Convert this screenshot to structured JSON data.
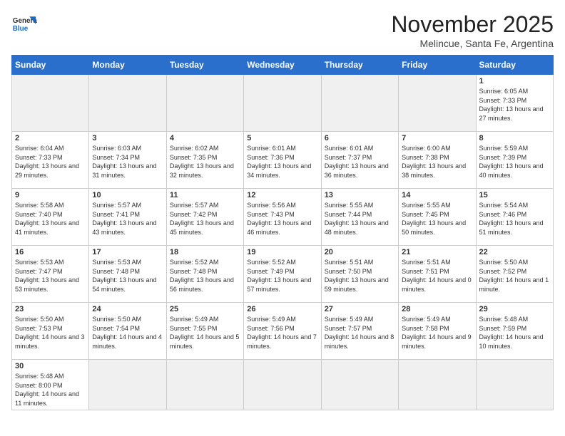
{
  "header": {
    "logo_general": "General",
    "logo_blue": "Blue",
    "title": "November 2025",
    "location": "Melincue, Santa Fe, Argentina"
  },
  "weekdays": [
    "Sunday",
    "Monday",
    "Tuesday",
    "Wednesday",
    "Thursday",
    "Friday",
    "Saturday"
  ],
  "days": [
    {
      "num": "",
      "info": ""
    },
    {
      "num": "",
      "info": ""
    },
    {
      "num": "",
      "info": ""
    },
    {
      "num": "",
      "info": ""
    },
    {
      "num": "",
      "info": ""
    },
    {
      "num": "",
      "info": ""
    },
    {
      "num": "1",
      "info": "Sunrise: 6:05 AM\nSunset: 7:33 PM\nDaylight: 13 hours\nand 27 minutes."
    },
    {
      "num": "2",
      "info": "Sunrise: 6:04 AM\nSunset: 7:33 PM\nDaylight: 13 hours\nand 29 minutes."
    },
    {
      "num": "3",
      "info": "Sunrise: 6:03 AM\nSunset: 7:34 PM\nDaylight: 13 hours\nand 31 minutes."
    },
    {
      "num": "4",
      "info": "Sunrise: 6:02 AM\nSunset: 7:35 PM\nDaylight: 13 hours\nand 32 minutes."
    },
    {
      "num": "5",
      "info": "Sunrise: 6:01 AM\nSunset: 7:36 PM\nDaylight: 13 hours\nand 34 minutes."
    },
    {
      "num": "6",
      "info": "Sunrise: 6:01 AM\nSunset: 7:37 PM\nDaylight: 13 hours\nand 36 minutes."
    },
    {
      "num": "7",
      "info": "Sunrise: 6:00 AM\nSunset: 7:38 PM\nDaylight: 13 hours\nand 38 minutes."
    },
    {
      "num": "8",
      "info": "Sunrise: 5:59 AM\nSunset: 7:39 PM\nDaylight: 13 hours\nand 40 minutes."
    },
    {
      "num": "9",
      "info": "Sunrise: 5:58 AM\nSunset: 7:40 PM\nDaylight: 13 hours\nand 41 minutes."
    },
    {
      "num": "10",
      "info": "Sunrise: 5:57 AM\nSunset: 7:41 PM\nDaylight: 13 hours\nand 43 minutes."
    },
    {
      "num": "11",
      "info": "Sunrise: 5:57 AM\nSunset: 7:42 PM\nDaylight: 13 hours\nand 45 minutes."
    },
    {
      "num": "12",
      "info": "Sunrise: 5:56 AM\nSunset: 7:43 PM\nDaylight: 13 hours\nand 46 minutes."
    },
    {
      "num": "13",
      "info": "Sunrise: 5:55 AM\nSunset: 7:44 PM\nDaylight: 13 hours\nand 48 minutes."
    },
    {
      "num": "14",
      "info": "Sunrise: 5:55 AM\nSunset: 7:45 PM\nDaylight: 13 hours\nand 50 minutes."
    },
    {
      "num": "15",
      "info": "Sunrise: 5:54 AM\nSunset: 7:46 PM\nDaylight: 13 hours\nand 51 minutes."
    },
    {
      "num": "16",
      "info": "Sunrise: 5:53 AM\nSunset: 7:47 PM\nDaylight: 13 hours\nand 53 minutes."
    },
    {
      "num": "17",
      "info": "Sunrise: 5:53 AM\nSunset: 7:48 PM\nDaylight: 13 hours\nand 54 minutes."
    },
    {
      "num": "18",
      "info": "Sunrise: 5:52 AM\nSunset: 7:48 PM\nDaylight: 13 hours\nand 56 minutes."
    },
    {
      "num": "19",
      "info": "Sunrise: 5:52 AM\nSunset: 7:49 PM\nDaylight: 13 hours\nand 57 minutes."
    },
    {
      "num": "20",
      "info": "Sunrise: 5:51 AM\nSunset: 7:50 PM\nDaylight: 13 hours\nand 59 minutes."
    },
    {
      "num": "21",
      "info": "Sunrise: 5:51 AM\nSunset: 7:51 PM\nDaylight: 14 hours\nand 0 minutes."
    },
    {
      "num": "22",
      "info": "Sunrise: 5:50 AM\nSunset: 7:52 PM\nDaylight: 14 hours\nand 1 minute."
    },
    {
      "num": "23",
      "info": "Sunrise: 5:50 AM\nSunset: 7:53 PM\nDaylight: 14 hours\nand 3 minutes."
    },
    {
      "num": "24",
      "info": "Sunrise: 5:50 AM\nSunset: 7:54 PM\nDaylight: 14 hours\nand 4 minutes."
    },
    {
      "num": "25",
      "info": "Sunrise: 5:49 AM\nSunset: 7:55 PM\nDaylight: 14 hours\nand 5 minutes."
    },
    {
      "num": "26",
      "info": "Sunrise: 5:49 AM\nSunset: 7:56 PM\nDaylight: 14 hours\nand 7 minutes."
    },
    {
      "num": "27",
      "info": "Sunrise: 5:49 AM\nSunset: 7:57 PM\nDaylight: 14 hours\nand 8 minutes."
    },
    {
      "num": "28",
      "info": "Sunrise: 5:49 AM\nSunset: 7:58 PM\nDaylight: 14 hours\nand 9 minutes."
    },
    {
      "num": "29",
      "info": "Sunrise: 5:48 AM\nSunset: 7:59 PM\nDaylight: 14 hours\nand 10 minutes."
    },
    {
      "num": "30",
      "info": "Sunrise: 5:48 AM\nSunset: 8:00 PM\nDaylight: 14 hours\nand 11 minutes."
    },
    {
      "num": "",
      "info": ""
    },
    {
      "num": "",
      "info": ""
    },
    {
      "num": "",
      "info": ""
    },
    {
      "num": "",
      "info": ""
    },
    {
      "num": "",
      "info": ""
    },
    {
      "num": "",
      "info": ""
    }
  ]
}
